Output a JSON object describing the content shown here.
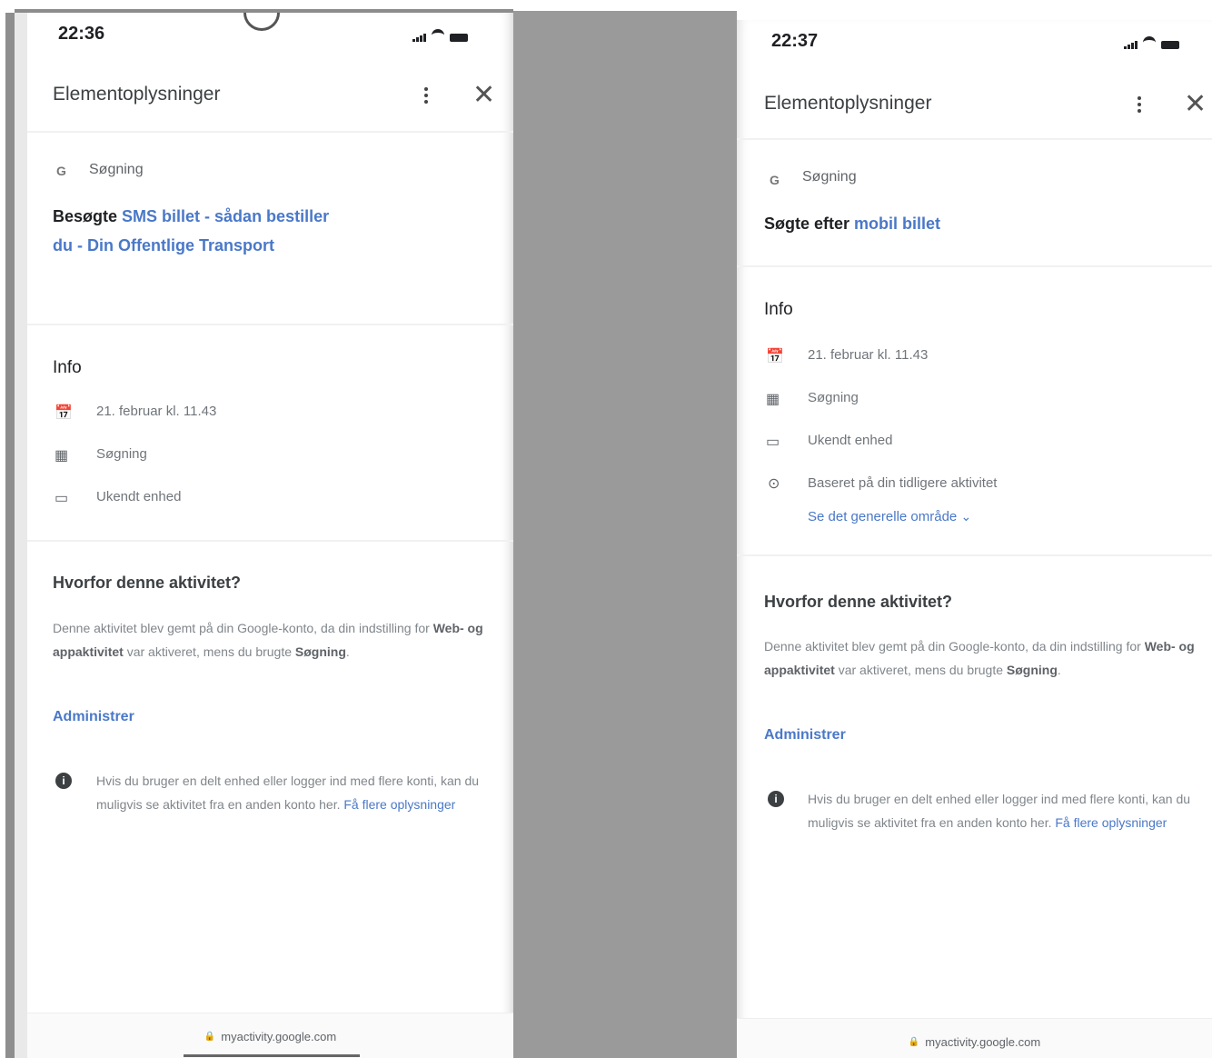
{
  "left": {
    "time": "22:36",
    "title": "Elementoplysninger",
    "product_icon": "G",
    "product": "Søgning",
    "headline_prefix": "Besøgte",
    "headline_link_line1": "SMS billet - sådan bestiller",
    "headline_link_line2": "du - Din Offentlige Transport",
    "info_title": "Info",
    "info_rows": [
      {
        "icon": "calendar-icon",
        "text": "21. februar kl. 11.43"
      },
      {
        "icon": "product-grid-icon",
        "text": "Søgning"
      },
      {
        "icon": "device-icon",
        "text": "Ukendt enhed"
      }
    ],
    "why_title": "Hvorfor denne aktivitet?",
    "why_text_1": "Denne aktivitet blev gemt på din Google-konto, da din indstilling for",
    "why_bold_1": "Web- og appaktivitet",
    "why_text_2": "var aktiveret, mens du brugte",
    "why_bold_2": "Søgning",
    "why_text_3": ".",
    "manage": "Administrer",
    "notice_text": "Hvis du bruger en delt enhed eller logger ind med flere konti, kan du muligvis se aktivitet fra en anden konto her.",
    "notice_link": "Få flere oplysninger",
    "footer": "myactivity.google.com"
  },
  "right": {
    "time": "22:37",
    "title": "Elementoplysninger",
    "product_icon": "G",
    "product": "Søgning",
    "headline_prefix": "Søgte efter",
    "headline_link": "mobil billet",
    "info_title": "Info",
    "info_rows": [
      {
        "icon": "calendar-icon",
        "text": "21. februar kl. 11.43"
      },
      {
        "icon": "product-grid-icon",
        "text": "Søgning"
      },
      {
        "icon": "device-icon",
        "text": "Ukendt enhed"
      },
      {
        "icon": "location-pin-icon",
        "text": "Baseret på din tidligere aktivitet"
      }
    ],
    "location_link": "Se det generelle område",
    "why_title": "Hvorfor denne aktivitet?",
    "why_text_1": "Denne aktivitet blev gemt på din Google-konto, da din indstilling for",
    "why_bold_1": "Web- og appaktivitet",
    "why_text_2": "var aktiveret, mens du brugte",
    "why_bold_2": "Søgning",
    "why_text_3": ".",
    "manage": "Administrer",
    "notice_text": "Hvis du bruger en delt enhed eller logger ind med flere konti, kan du muligvis se aktivitet fra en anden konto her.",
    "notice_link": "Få flere oplysninger",
    "footer": "myactivity.google.com"
  },
  "colors": {
    "link": "#4a78c8",
    "gap": "#9a9a9a"
  }
}
